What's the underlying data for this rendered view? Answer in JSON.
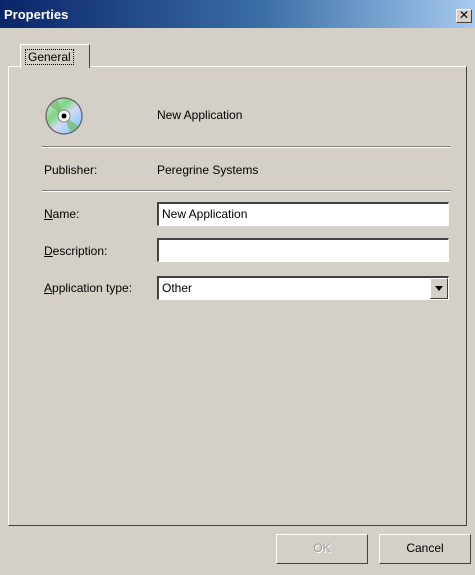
{
  "window": {
    "title": "Properties",
    "close_glyph": "✕"
  },
  "tabs": [
    {
      "label": "General",
      "selected": true
    }
  ],
  "general": {
    "app_name": "New Application",
    "icon": "cd-disc-icon",
    "publisher_label": "Publisher:",
    "publisher_value": "Peregrine Systems",
    "name_label_first": "N",
    "name_label_rest": "ame:",
    "name_value": "New Application",
    "description_label_first": "D",
    "description_label_rest": "escription:",
    "description_value": "",
    "apptype_label_first": "A",
    "apptype_label_rest": "pplication type:",
    "apptype_value": "Other"
  },
  "buttons": {
    "ok_label": "OK",
    "ok_enabled": false,
    "cancel_label": "Cancel"
  }
}
